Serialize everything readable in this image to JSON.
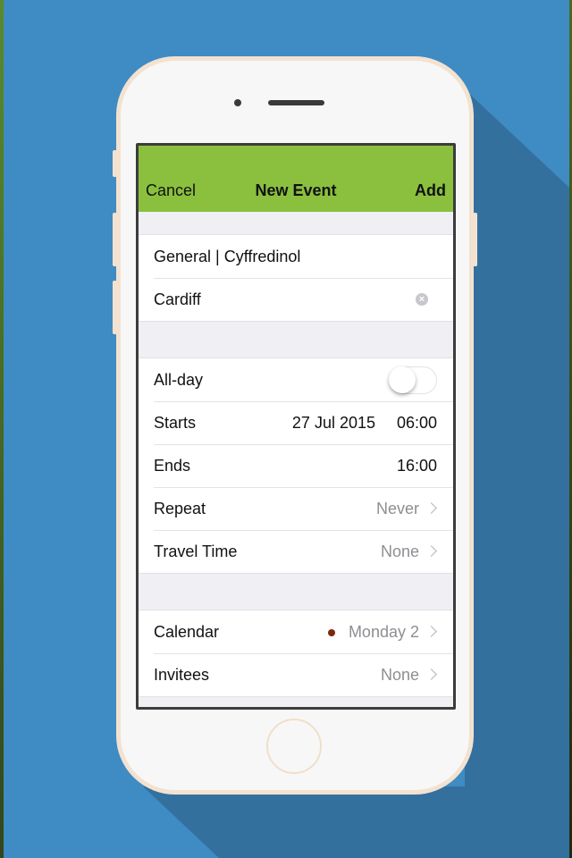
{
  "colors": {
    "background": "#3f8bc4",
    "background_shadow": "#34709e",
    "navbar": "#8ac03e",
    "phone_body": "#f7f7f7",
    "phone_trim": "#f3e2d0",
    "calendar_dot": "#7a2a0a"
  },
  "navbar": {
    "cancel_label": "Cancel",
    "title": "New Event",
    "add_label": "Add"
  },
  "details": {
    "title_value": "General | Cyffredinol",
    "location_value": "Cardiff",
    "clear_icon": "clear-circle-icon"
  },
  "timing": {
    "allday_label": "All-day",
    "allday_on": false,
    "starts_label": "Starts",
    "starts_date": "27 Jul 2015",
    "starts_time": "06:00",
    "ends_label": "Ends",
    "ends_time": "16:00",
    "repeat_label": "Repeat",
    "repeat_value": "Never",
    "travel_label": "Travel Time",
    "travel_value": "None"
  },
  "extra": {
    "calendar_label": "Calendar",
    "calendar_value": "Monday 2",
    "invitees_label": "Invitees",
    "invitees_value": "None"
  }
}
